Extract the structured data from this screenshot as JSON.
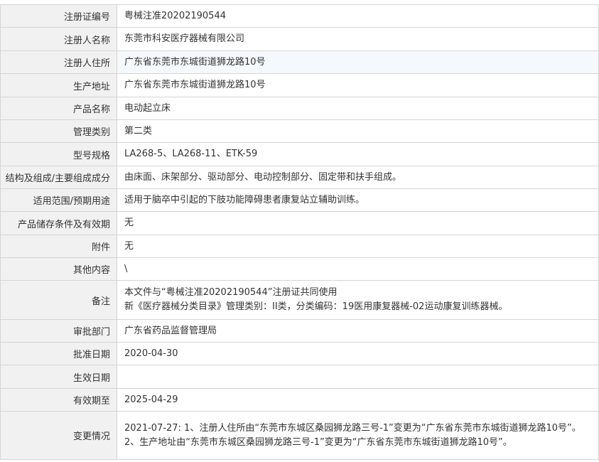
{
  "rows": [
    {
      "label": "注册证编号",
      "lines": [
        "粤械注准20202190544"
      ]
    },
    {
      "label": "注册人名称",
      "lines": [
        "东莞市科安医疗器械有限公司"
      ]
    },
    {
      "label": "注册人住所",
      "lines": [
        "广东省东莞市东城街道狮龙路10号"
      ]
    },
    {
      "label": "生产地址",
      "lines": [
        "广东省东莞市东城街道狮龙路10号"
      ]
    },
    {
      "label": "产品名称",
      "lines": [
        "电动起立床"
      ]
    },
    {
      "label": "管理类别",
      "lines": [
        "第二类"
      ]
    },
    {
      "label": "型号规格",
      "lines": [
        "LA268-5、LA268-11、ETK-59"
      ]
    },
    {
      "label": "结构及组成/主要组成成分",
      "lines": [
        "由床面、床架部分、驱动部分、电动控制部分、固定带和扶手组成。"
      ]
    },
    {
      "label": "适用范围/预期用途",
      "lines": [
        "适用于脑卒中引起的下肢功能障碍患者康复站立辅助训练。"
      ]
    },
    {
      "label": "产品储存条件及有效期",
      "lines": [
        "无"
      ]
    },
    {
      "label": "附件",
      "lines": [
        "无"
      ]
    },
    {
      "label": "其他内容",
      "lines": [
        "\\"
      ]
    },
    {
      "label": "备注",
      "lines": [
        "本文件与“粤械注准20202190544”注册证共同使用",
        "新《医疗器械分类目录》管理类别：II类，分类编码：19医用康复器械-02运动康复训练器械。"
      ]
    },
    {
      "label": "审批部门",
      "lines": [
        "广东省药品监督管理局"
      ]
    },
    {
      "label": "批准日期",
      "lines": [
        "2020-04-30"
      ]
    },
    {
      "label": "生效日期",
      "lines": [
        ""
      ]
    },
    {
      "label": "有效期至",
      "lines": [
        "2025-04-29"
      ]
    },
    {
      "label": "变更情况",
      "lines": [
        "2021-07-27: 1、注册人住所由“东莞市东城区桑园狮龙路三号-1”变更为“广东省东莞市东城街道狮龙路10号”。",
        "2、生产地址由“东莞市东城区桑园狮龙路三号-1”变更为“广东省东莞市东城街道狮龙路10号”。"
      ]
    }
  ]
}
